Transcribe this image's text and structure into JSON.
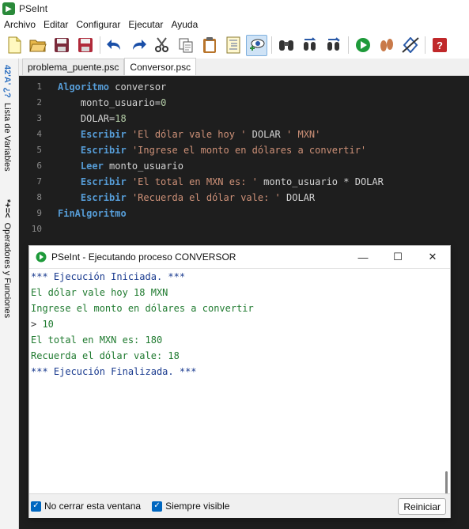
{
  "app": {
    "title": "PSeInt"
  },
  "menu": [
    "Archivo",
    "Editar",
    "Configurar",
    "Ejecutar",
    "Ayuda"
  ],
  "toolbar": {
    "buttons": [
      "new-file",
      "open-file",
      "save",
      "save-as",
      "undo",
      "redo",
      "cut",
      "copy",
      "paste",
      "format",
      "find",
      "variables-watch",
      "search",
      "replace",
      "replace-all",
      "run",
      "step-by-step",
      "flowchart",
      "help"
    ]
  },
  "sidebar": {
    "variables_tab": {
      "icon": "42'A' ¿?",
      "label": "Lista de Variables"
    },
    "operators_tab": {
      "icon": "*+=<",
      "label": "Operadores y Funciones"
    }
  },
  "tabs": [
    {
      "label": "problema_puente.psc",
      "active": false
    },
    {
      "label": "Conversor.psc",
      "active": true
    }
  ],
  "editor": {
    "line_numbers": [
      "1",
      "2",
      "3",
      "4",
      "5",
      "6",
      "7",
      "8",
      "9",
      "10"
    ],
    "lines": [
      [
        {
          "t": "Algoritmo",
          "c": "kw"
        },
        {
          "t": " conversor",
          "c": ""
        }
      ],
      [
        {
          "t": "    monto_usuario",
          "c": ""
        },
        {
          "t": "=",
          "c": "op"
        },
        {
          "t": "0",
          "c": "num"
        }
      ],
      [
        {
          "t": "    DOLAR",
          "c": ""
        },
        {
          "t": "=",
          "c": "op"
        },
        {
          "t": "18",
          "c": "num"
        }
      ],
      [
        {
          "t": "    Escribir",
          "c": "kw"
        },
        {
          "t": " ",
          "c": ""
        },
        {
          "t": "'El dólar vale hoy '",
          "c": "str"
        },
        {
          "t": " DOLAR ",
          "c": ""
        },
        {
          "t": "' MXN'",
          "c": "str"
        }
      ],
      [
        {
          "t": "    Escribir",
          "c": "kw"
        },
        {
          "t": " ",
          "c": ""
        },
        {
          "t": "'Ingrese el monto en dólares a convertir'",
          "c": "str"
        }
      ],
      [
        {
          "t": "    Leer",
          "c": "kw"
        },
        {
          "t": " monto_usuario",
          "c": ""
        }
      ],
      [
        {
          "t": "    Escribir",
          "c": "kw"
        },
        {
          "t": " ",
          "c": ""
        },
        {
          "t": "'El total en MXN es: '",
          "c": "str"
        },
        {
          "t": " monto_usuario ",
          "c": ""
        },
        {
          "t": "*",
          "c": "op"
        },
        {
          "t": " DOLAR",
          "c": ""
        }
      ],
      [
        {
          "t": "    Escribir",
          "c": "kw"
        },
        {
          "t": " ",
          "c": ""
        },
        {
          "t": "'Recuerda el dólar vale: '",
          "c": "str"
        },
        {
          "t": " DOLAR",
          "c": ""
        }
      ],
      [
        {
          "t": "FinAlgoritmo",
          "c": "kw"
        }
      ],
      []
    ]
  },
  "run_window": {
    "title": "PSeInt - Ejecutando proceso CONVERSOR",
    "controls": {
      "minimize": "—",
      "maximize": "☐",
      "close": "✕"
    },
    "console": [
      {
        "text": "*** Ejecución Iniciada. ***",
        "kind": "sys"
      },
      {
        "text": "El dólar vale hoy 18 MXN",
        "kind": "out"
      },
      {
        "text": "Ingrese el monto en dólares a convertir",
        "kind": "out"
      },
      {
        "text": "> ",
        "value": "10",
        "kind": "in"
      },
      {
        "text": "El total en MXN es: 180",
        "kind": "out"
      },
      {
        "text": "Recuerda el dólar vale: 18",
        "kind": "out"
      },
      {
        "text": "*** Ejecución Finalizada. ***",
        "kind": "sys"
      }
    ],
    "footer": {
      "keep_open_label": "No cerrar esta ventana",
      "keep_open_checked": true,
      "always_visible_label": "Siempre visible",
      "always_visible_checked": true,
      "reset_label": "Reiniciar"
    }
  }
}
